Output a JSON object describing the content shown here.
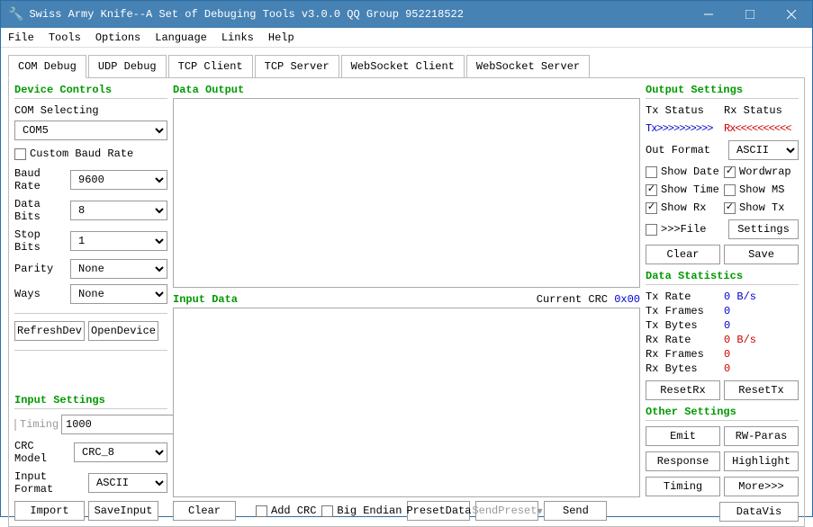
{
  "title": "Swiss Army Knife--A Set of Debuging Tools v3.0.0 QQ Group 952218522",
  "menu": [
    "File",
    "Tools",
    "Options",
    "Language",
    "Links",
    "Help"
  ],
  "tabs": [
    "COM Debug",
    "UDP Debug",
    "TCP Client",
    "TCP Server",
    "WebSocket Client",
    "WebSocket Server"
  ],
  "device_controls": {
    "title": "Device Controls",
    "com_selecting_label": "COM Selecting",
    "com_port": "COM5",
    "custom_baud": "Custom Baud Rate",
    "baud_label": "Baud Rate",
    "baud_val": "9600",
    "data_label": "Data Bits",
    "data_val": "8",
    "stop_label": "Stop Bits",
    "stop_val": "1",
    "parity_label": "Parity",
    "parity_val": "None",
    "ways_label": "Ways",
    "ways_val": "None",
    "refresh": "RefreshDev",
    "open": "OpenDevice"
  },
  "data_output": {
    "title": "Data Output"
  },
  "output_settings": {
    "title": "Output Settings",
    "tx_status": "Tx Status",
    "rx_status": "Rx Status",
    "tx_arrow": "Tx>>>>>>>>>>",
    "rx_arrow": "Rx<<<<<<<<<<",
    "out_format": "Out Format",
    "out_format_val": "ASCII",
    "show_date": "Show Date",
    "wordwrap": "Wordwrap",
    "show_time": "Show Time",
    "show_ms": "Show MS",
    "show_rx": "Show Rx",
    "show_tx": "Show Tx",
    "to_file": ">>>File",
    "settings": "Settings",
    "clear": "Clear",
    "save": "Save"
  },
  "data_stats": {
    "title": "Data Statistics",
    "tx_rate": "Tx Rate",
    "tx_rate_v": "0 B/s",
    "tx_frames": "Tx Frames",
    "tx_frames_v": "0",
    "tx_bytes": "Tx Bytes",
    "tx_bytes_v": "0",
    "rx_rate": "Rx Rate",
    "rx_rate_v": "0 B/s",
    "rx_frames": "Rx Frames",
    "rx_frames_v": "0",
    "rx_bytes": "Rx Bytes",
    "rx_bytes_v": "0",
    "reset_rx": "ResetRx",
    "reset_tx": "ResetTx"
  },
  "input_settings": {
    "title": "Input Settings",
    "timing": "Timing",
    "timing_val": "1000",
    "crc_model": "CRC Model",
    "crc_val": "CRC_8",
    "input_format": "Input Format",
    "input_format_val": "ASCII",
    "import": "Import",
    "save_input": "SaveInput"
  },
  "input_data": {
    "title": "Input Data",
    "current_crc": "Current CRC",
    "crc_val": "0x00",
    "clear": "Clear",
    "add_crc": "Add CRC",
    "big_endian": "Big Endian",
    "preset_data": "PresetData",
    "send_preset": "SendPreset",
    "send": "Send"
  },
  "other_settings": {
    "title": "Other Settings",
    "emit": "Emit",
    "rw_paras": "RW-Paras",
    "response": "Response",
    "highlight": "Highlight",
    "timing": "Timing",
    "more": "More>>>",
    "datavis": "DataVis"
  }
}
